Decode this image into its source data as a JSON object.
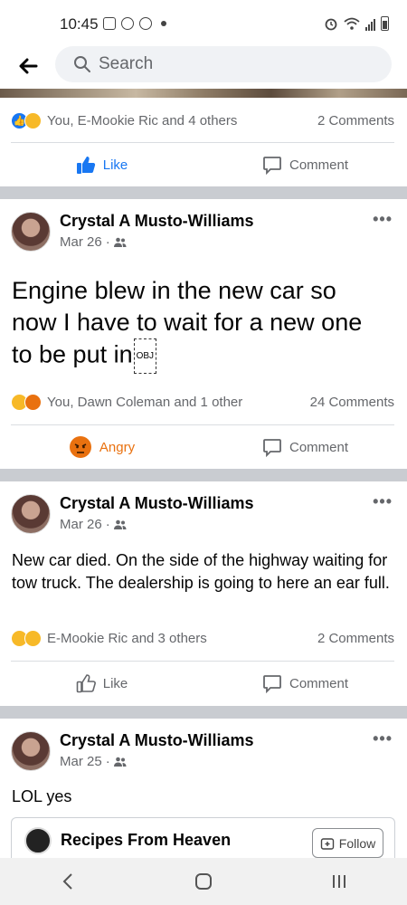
{
  "status_bar": {
    "time": "10:45"
  },
  "search": {
    "placeholder": "Search"
  },
  "post0": {
    "reactions_text": "You, E-Mookie Ric and 4 others",
    "comments": "2 Comments",
    "like_label": "Like",
    "comment_label": "Comment"
  },
  "post1": {
    "author": "Crystal A Musto-Williams",
    "date": "Mar 26",
    "text_line1": "Engine blew in the new car so",
    "text_line2": "now I have to wait for a new one",
    "text_line3": "to be put in",
    "obj_marker": "OBJ",
    "reactions_text": "You, Dawn Coleman and 1 other",
    "comments": "24 Comments",
    "reaction_label": "Angry",
    "comment_label": "Comment"
  },
  "post2": {
    "author": "Crystal A Musto-Williams",
    "date": "Mar 26",
    "text": "New car died. On the side of the highway waiting for tow truck. The dealership is going to here an ear full.",
    "reactions_text": "E-Mookie Ric and 3 others",
    "comments": "2 Comments",
    "like_label": "Like",
    "comment_label": "Comment"
  },
  "post3": {
    "author": "Crystal A Musto-Williams",
    "date": "Mar 25",
    "text": "LOL yes",
    "shared_page": "Recipes From Heaven",
    "follow_label": "Follow"
  },
  "colors": {
    "accent": "#1877f2",
    "angry": "#e9710f",
    "divider": "#c9ccd1"
  }
}
